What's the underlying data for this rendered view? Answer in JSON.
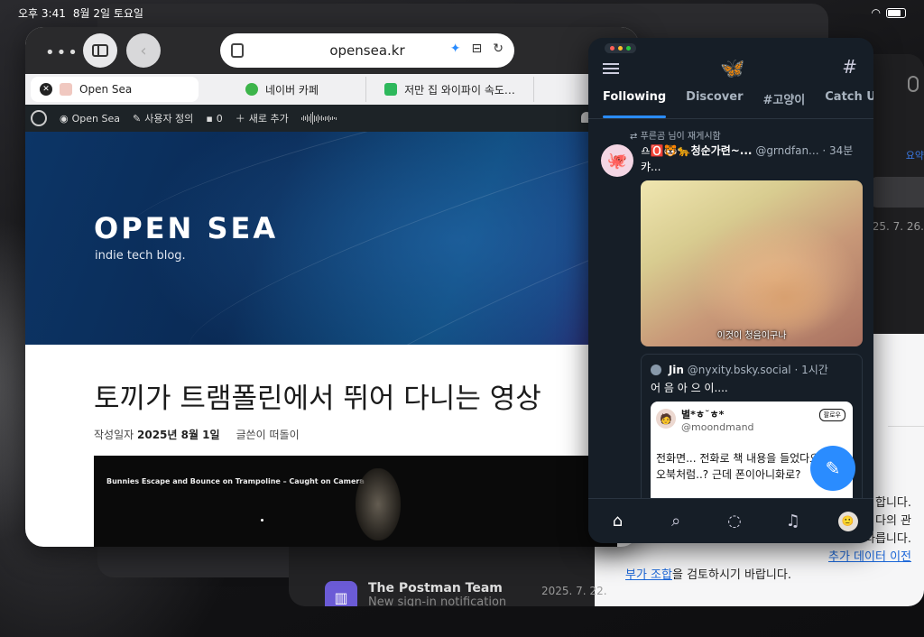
{
  "status": {
    "time": "오후 3:41",
    "date": "8월 2일 토요일"
  },
  "safari": {
    "url": "opensea.kr",
    "tabs": [
      {
        "title": "Open Sea",
        "active": true
      },
      {
        "title": "네이버 카페",
        "active": false
      },
      {
        "title": "저만 집 와이파이 속도…",
        "active": false
      }
    ],
    "wp_bar": {
      "site": "Open Sea",
      "customize": "사용자 정의",
      "comments": "0",
      "new": "새로 추가",
      "right": "인"
    },
    "hero": {
      "title": "OPEN SEA",
      "subtitle": "indie tech blog."
    },
    "post": {
      "title": "토끼가 트램폴린에서 뛰어 다니는 영상",
      "date_label": "작성일자",
      "date": "2025년 8월 1일",
      "author": "글쓴이 떠돌이",
      "video_title": "Bunnies Escape and Bounce on Trampoline – Caught on Camera"
    }
  },
  "bluesky": {
    "tabs": [
      "Following",
      "Discover",
      "#고양이",
      "Catch Up"
    ],
    "post": {
      "repost": "푸른곰 님이 재게시함",
      "author": "♎🅾️🐯🐆청순가련~...",
      "handle": "@grndfan...",
      "time": "· 34분",
      "text": "캬...",
      "image_caption": "이것이 청음이구나"
    },
    "quote": {
      "author": "Jin",
      "handle": "@nyxity.bsky.social",
      "time": "· 1시간",
      "text": "어 음 아 으 이....",
      "inner_name": "별*ㅎ˘ㅎ*",
      "inner_handle": "@moondmand",
      "inner_badge": "팔로우",
      "inner_text": "전화면... 전화로 책 내용을 들었다요 오디오북처럼..? 근데 폰이아니화로?"
    }
  },
  "background_app": {
    "postman_title": "The Postman Team",
    "postman_sub": "New sign-in notification",
    "postman_date": "2025. 7. 22.",
    "summary": "요약",
    "date1": "25. 7. 26.",
    "lines": [
      "합니다.",
      "다의 관",
      "다릅니다."
    ],
    "link_line_pre": "추가 데이터 이전",
    "link_line2": "부가 조합",
    "link_line2_post": "을 검토하시기 바랍니다."
  }
}
